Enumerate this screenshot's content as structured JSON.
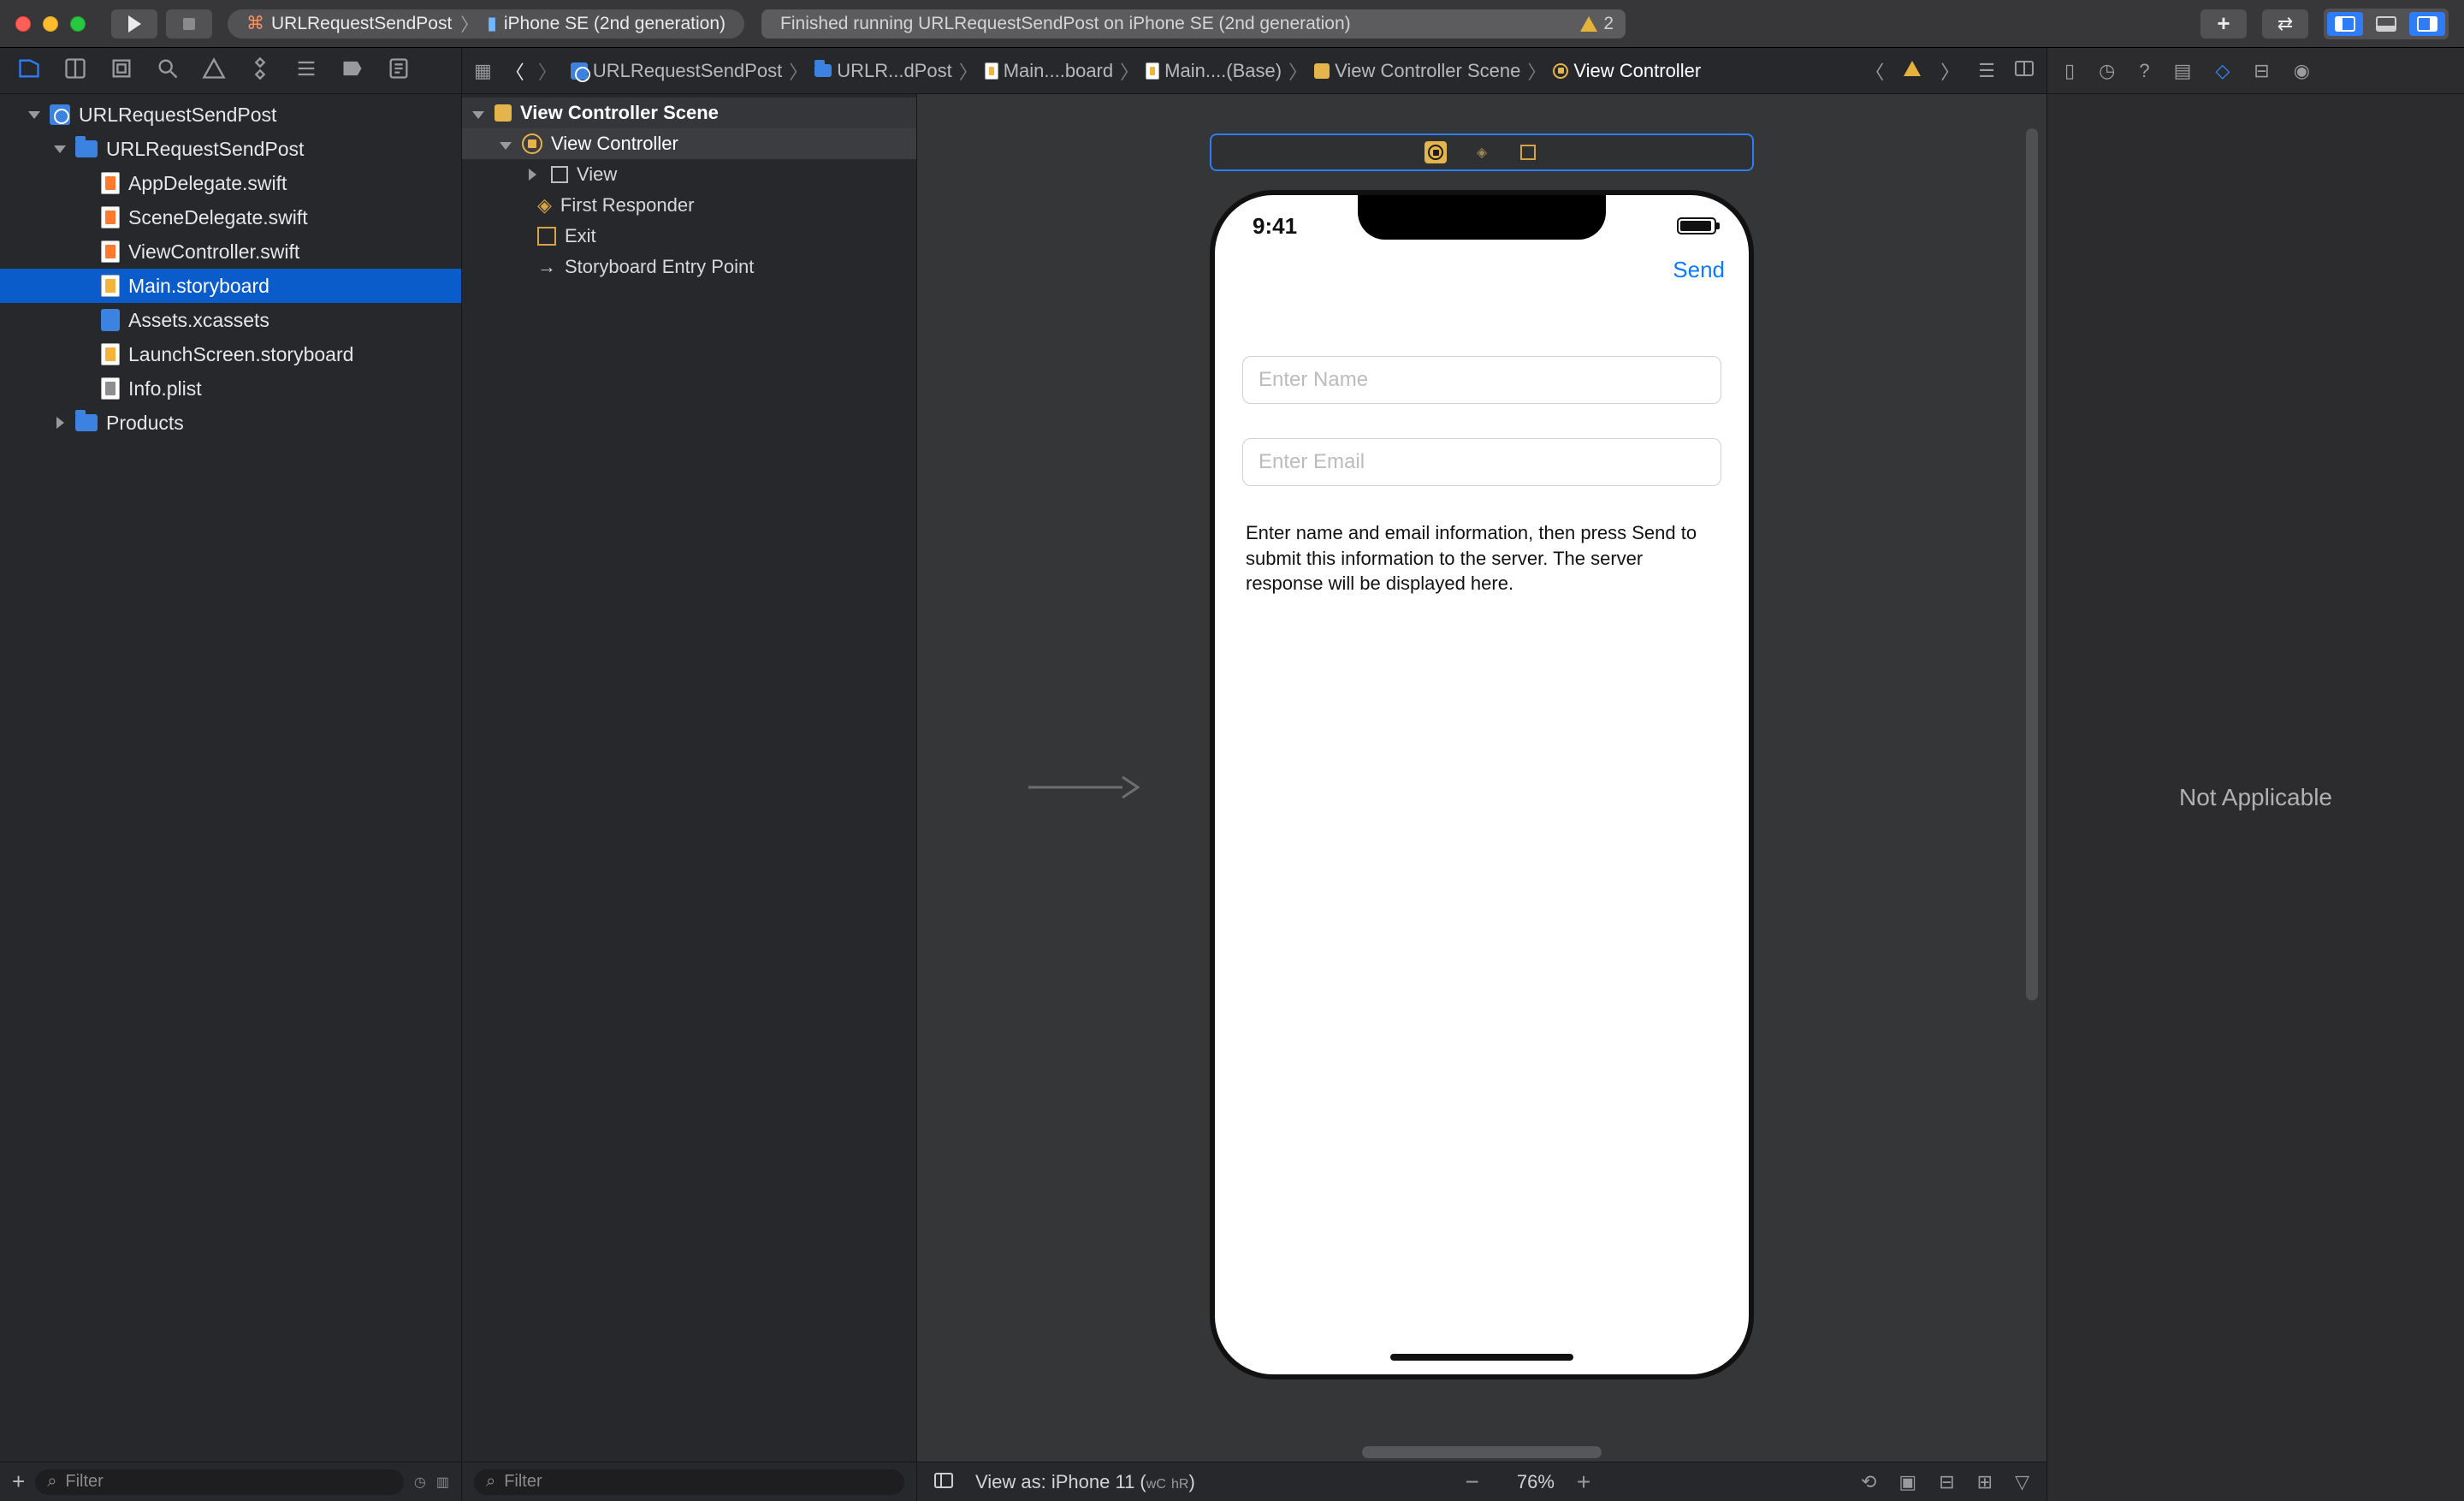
{
  "topbar": {
    "scheme_target": "URLRequestSendPost",
    "scheme_device": "iPhone SE (2nd generation)",
    "status_text": "Finished running URLRequestSendPost on iPhone SE (2nd generation)",
    "warning_count": "2"
  },
  "navigator": {
    "project": "URLRequestSendPost",
    "group": "URLRequestSendPost",
    "files": {
      "app_delegate": "AppDelegate.swift",
      "scene_delegate": "SceneDelegate.swift",
      "view_controller": "ViewController.swift",
      "main_storyboard": "Main.storyboard",
      "assets": "Assets.xcassets",
      "launch_screen": "LaunchScreen.storyboard",
      "info_plist": "Info.plist"
    },
    "products": "Products",
    "filter_placeholder": "Filter"
  },
  "breadcrumbs": {
    "items": [
      "URLRequestSendPost",
      "URLR...dPost",
      "Main....board",
      "Main....(Base)",
      "View Controller Scene",
      "View Controller"
    ]
  },
  "outline": {
    "scene_header": "View Controller Scene",
    "view_controller": "View Controller",
    "view": "View",
    "first_responder": "First Responder",
    "exit": "Exit",
    "entry_point": "Storyboard Entry Point",
    "filter_placeholder": "Filter"
  },
  "device_mock": {
    "time": "9:41",
    "send_button": "Send",
    "name_placeholder": "Enter Name",
    "email_placeholder": "Enter Email",
    "info_text": "Enter name and email information, then press Send to submit this information to the server.  The server response will be displayed here."
  },
  "canvas_footer": {
    "view_as": "View as: iPhone 11 (",
    "wc": "wC",
    "hr": "hR",
    "close_paren": ")",
    "zoom": "76%"
  },
  "inspector": {
    "not_applicable": "Not Applicable"
  }
}
